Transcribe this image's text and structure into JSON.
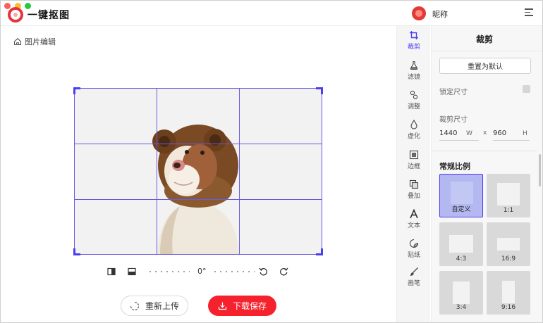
{
  "app": {
    "brand": "一键抠图",
    "nickname": "昵称"
  },
  "breadcrumb": {
    "label": "图片编辑"
  },
  "editor": {
    "angle": "0°",
    "reupload_label": "重新上传",
    "save_label": "下载保存"
  },
  "tools": [
    {
      "label": "裁剪",
      "icon": "crop-icon",
      "active": true
    },
    {
      "label": "滤镜",
      "icon": "filter-flask-icon"
    },
    {
      "label": "调整",
      "icon": "adjust-circles-icon"
    },
    {
      "label": "虚化",
      "icon": "blur-drop-icon"
    },
    {
      "label": "边框",
      "icon": "border-frame-icon"
    },
    {
      "label": "叠加",
      "icon": "overlay-layers-icon"
    },
    {
      "label": "文本",
      "icon": "text-a-icon"
    },
    {
      "label": "贴纸",
      "icon": "sticker-icon"
    },
    {
      "label": "画笔",
      "icon": "brush-icon"
    }
  ],
  "panel": {
    "title": "裁剪",
    "reset_label": "重置为默认",
    "lock_label": "锁定尺寸",
    "size_label": "裁剪尺寸",
    "width_value": "1440",
    "width_unit": "W",
    "height_value": "960",
    "height_unit": "H",
    "times": "x",
    "ratio_title": "常规比例",
    "ratios": [
      {
        "label": "自定义",
        "active": true
      },
      {
        "label": "1:1"
      },
      {
        "label": "4:3"
      },
      {
        "label": "16:9"
      },
      {
        "label": "3:4"
      },
      {
        "label": "9:16"
      }
    ]
  },
  "colors": {
    "accent": "#4b3df0",
    "save": "#f5222d",
    "logo": "#e8333a"
  }
}
